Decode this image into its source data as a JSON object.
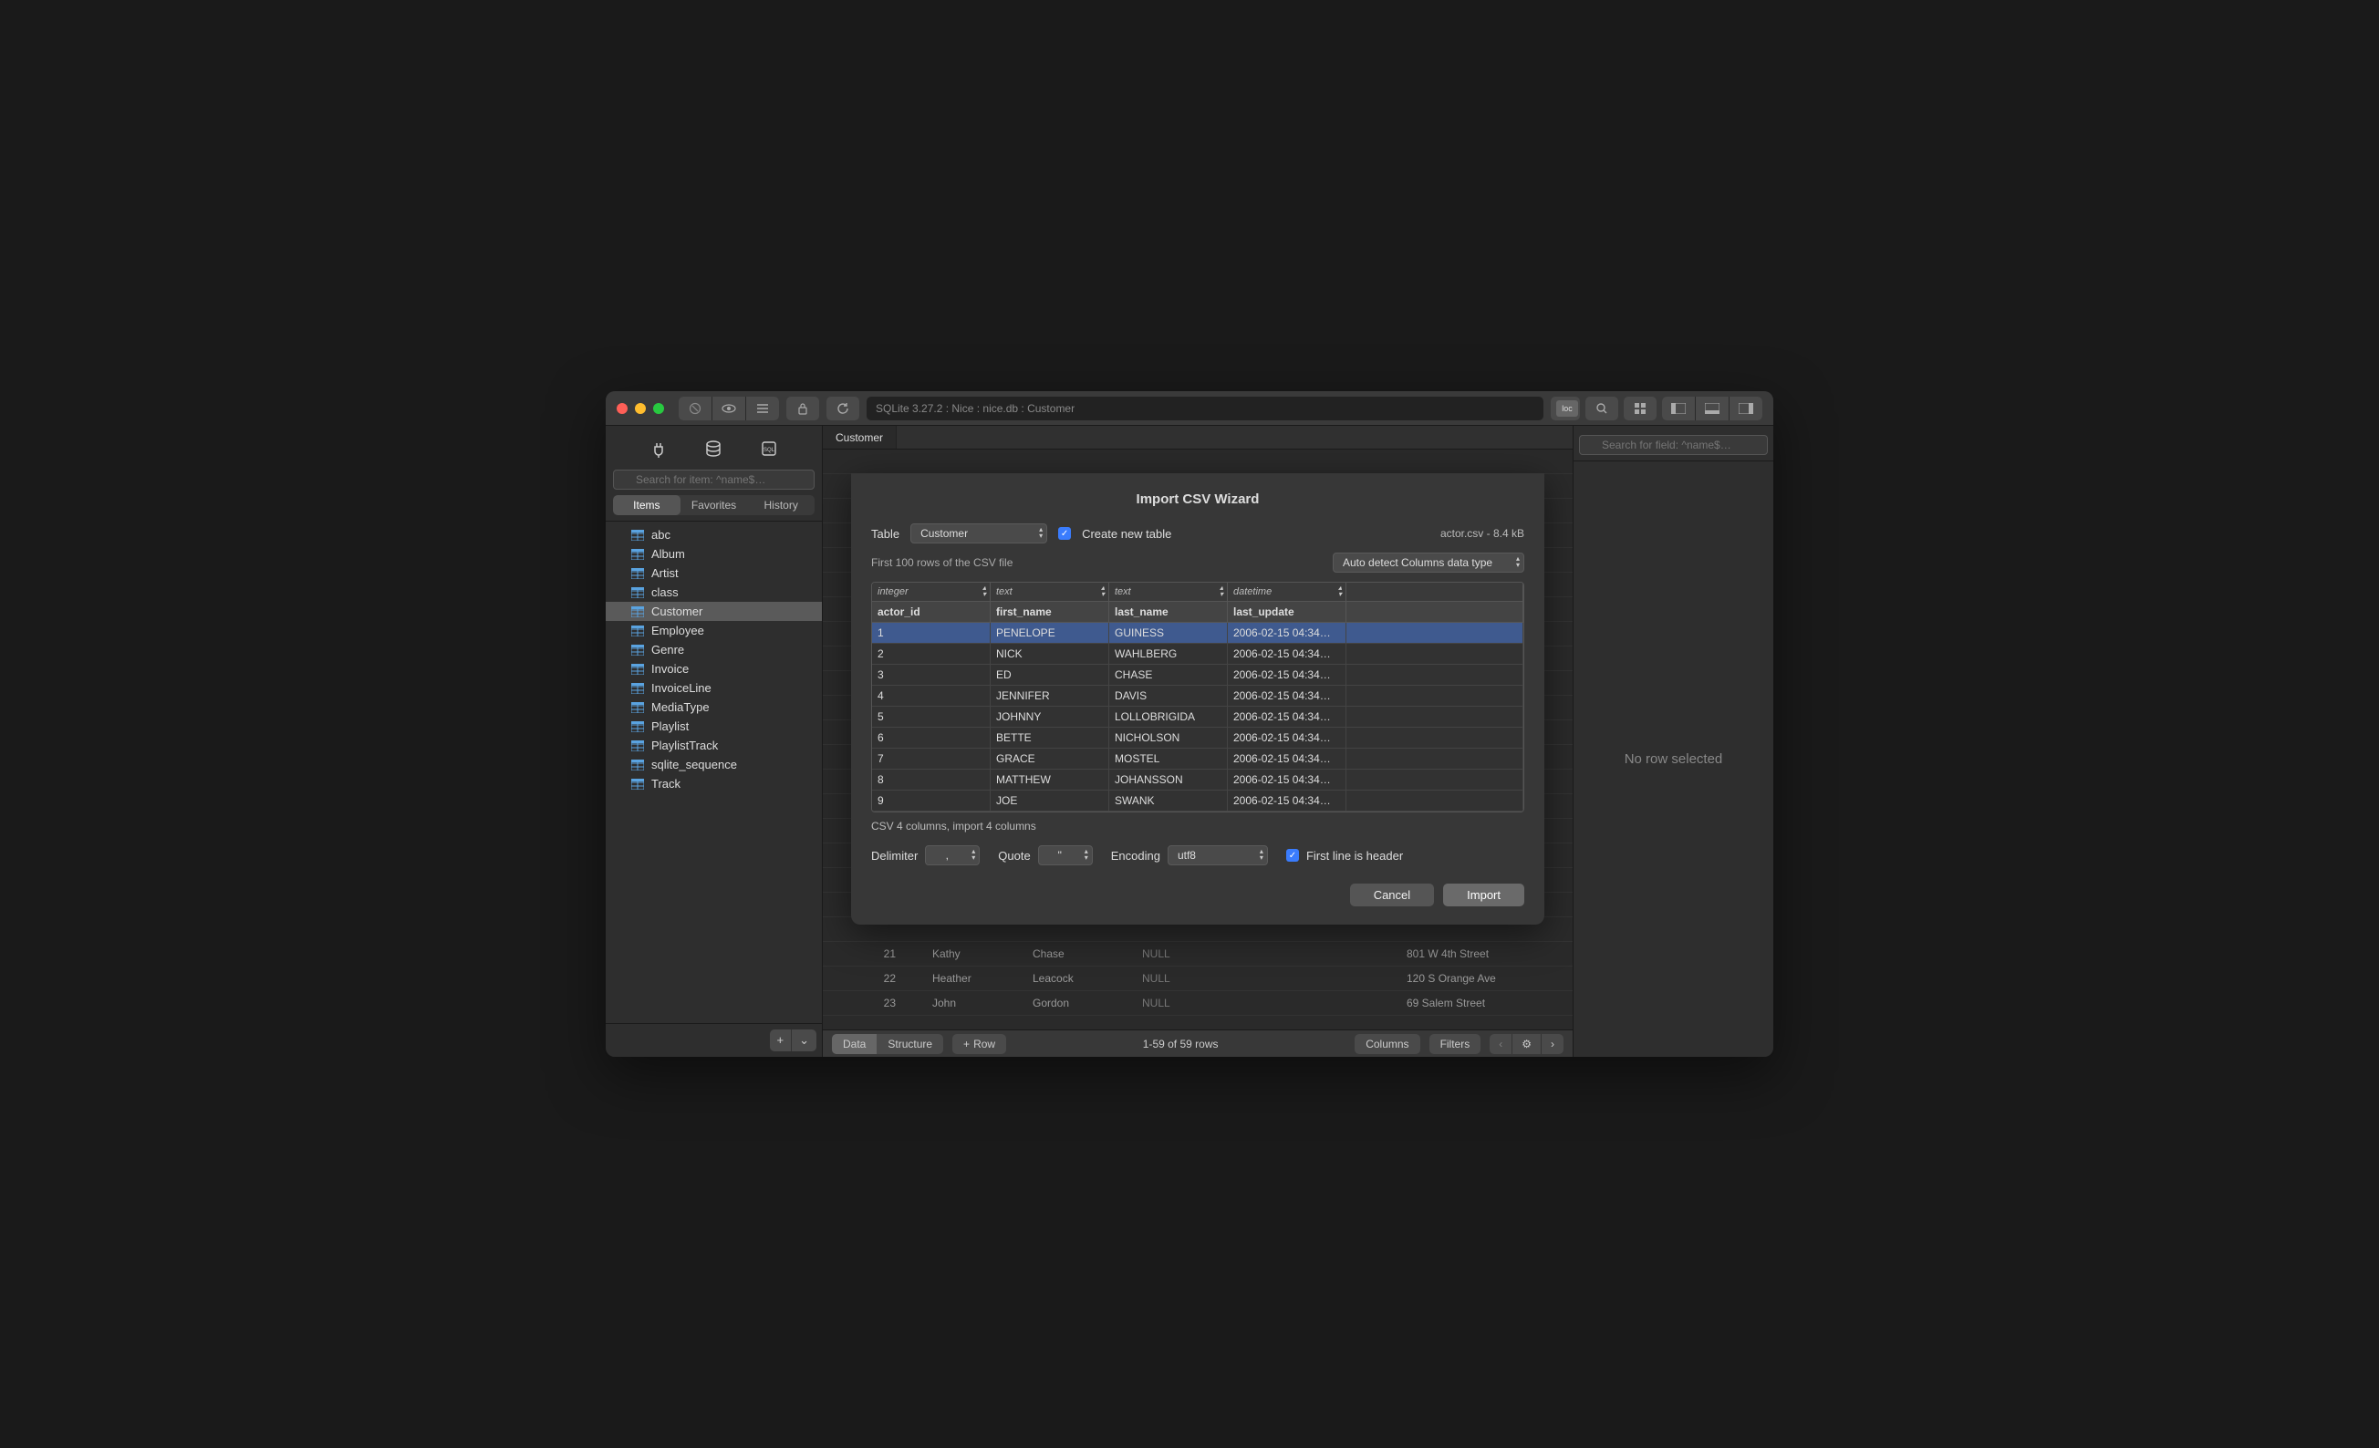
{
  "titlebar": {
    "path": "SQLite 3.27.2 : Nice : nice.db : Customer",
    "loc_badge": "loc"
  },
  "sidebar": {
    "search_placeholder": "Search for item: ^name$…",
    "segments": {
      "items": "Items",
      "favorites": "Favorites",
      "history": "History"
    },
    "tree": [
      {
        "label": "abc"
      },
      {
        "label": "Album"
      },
      {
        "label": "Artist"
      },
      {
        "label": "class"
      },
      {
        "label": "Customer",
        "selected": true
      },
      {
        "label": "Employee"
      },
      {
        "label": "Genre"
      },
      {
        "label": "Invoice"
      },
      {
        "label": "InvoiceLine"
      },
      {
        "label": "MediaType"
      },
      {
        "label": "Playlist"
      },
      {
        "label": "PlaylistTrack"
      },
      {
        "label": "sqlite_sequence"
      },
      {
        "label": "Track"
      }
    ]
  },
  "tabs": {
    "active": "Customer"
  },
  "inspector": {
    "search_placeholder": "Search for field: ^name$…",
    "empty": "No row selected"
  },
  "background_rows": [
    {
      "id": "21",
      "first": "Kathy",
      "last": "Chase",
      "c": "NULL",
      "addr": "801 W 4th Street"
    },
    {
      "id": "22",
      "first": "Heather",
      "last": "Leacock",
      "c": "NULL",
      "addr": "120 S Orange Ave"
    },
    {
      "id": "23",
      "first": "John",
      "last": "Gordon",
      "c": "NULL",
      "addr": "69 Salem Street"
    }
  ],
  "statusbar": {
    "data": "Data",
    "structure": "Structure",
    "row": "Row",
    "summary": "1-59 of 59 rows",
    "columns": "Columns",
    "filters": "Filters"
  },
  "modal": {
    "title": "Import CSV Wizard",
    "table_label": "Table",
    "table_value": "Customer",
    "create_new": "Create new table",
    "file_info": "actor.csv  -  8.4 kB",
    "first_rows_label": "First 100 rows of the CSV file",
    "type_detect": "Auto detect Columns data type",
    "types": [
      "integer",
      "text",
      "text",
      "datetime",
      ""
    ],
    "headers": [
      "actor_id",
      "first_name",
      "last_name",
      "last_update",
      ""
    ],
    "rows": [
      [
        "1",
        "PENELOPE",
        "GUINESS",
        "2006-02-15 04:34…",
        ""
      ],
      [
        "2",
        "NICK",
        "WAHLBERG",
        "2006-02-15 04:34…",
        ""
      ],
      [
        "3",
        "ED",
        "CHASE",
        "2006-02-15 04:34…",
        ""
      ],
      [
        "4",
        "JENNIFER",
        "DAVIS",
        "2006-02-15 04:34…",
        ""
      ],
      [
        "5",
        "JOHNNY",
        "LOLLOBRIGIDA",
        "2006-02-15 04:34…",
        ""
      ],
      [
        "6",
        "BETTE",
        "NICHOLSON",
        "2006-02-15 04:34…",
        ""
      ],
      [
        "7",
        "GRACE",
        "MOSTEL",
        "2006-02-15 04:34…",
        ""
      ],
      [
        "8",
        "MATTHEW",
        "JOHANSSON",
        "2006-02-15 04:34…",
        ""
      ],
      [
        "9",
        "JOE",
        "SWANK",
        "2006-02-15 04:34…",
        ""
      ]
    ],
    "summary": "CSV 4 columns, import 4 columns",
    "delimiter_label": "Delimiter",
    "delimiter_value": ",",
    "quote_label": "Quote",
    "quote_value": "\"",
    "encoding_label": "Encoding",
    "encoding_value": "utf8",
    "first_line_header": "First line is header",
    "cancel": "Cancel",
    "import": "Import"
  }
}
